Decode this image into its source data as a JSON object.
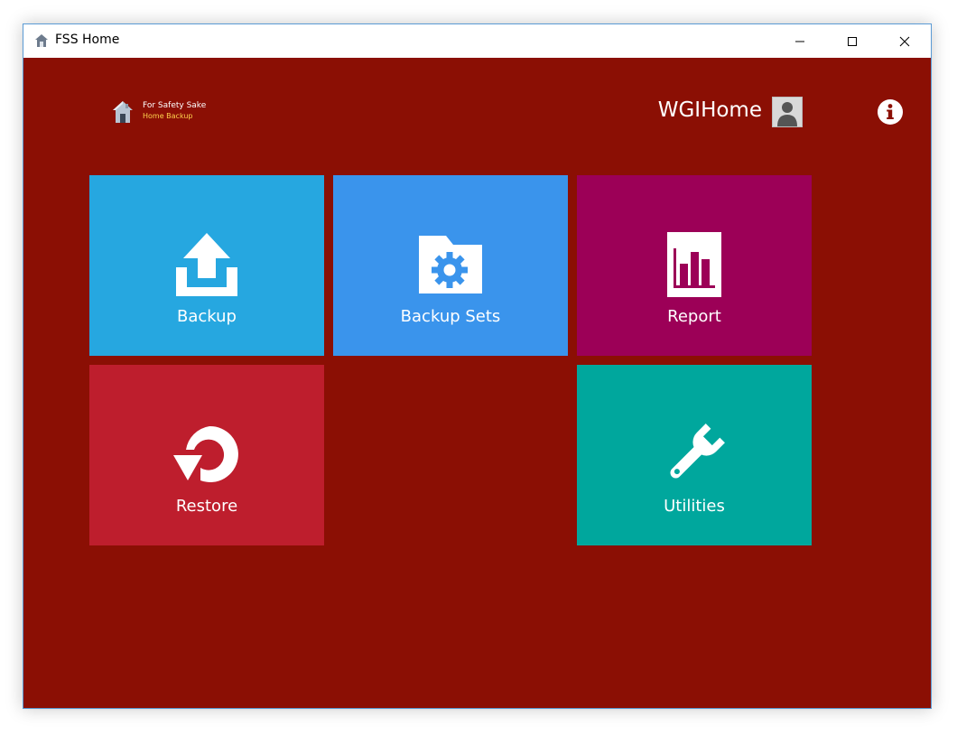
{
  "window": {
    "title": "FSS Home"
  },
  "brand": {
    "line1": "For Safety Sake",
    "line2": "Home Backup"
  },
  "user": {
    "name": "WGIHome"
  },
  "tiles": [
    {
      "label": "Backup",
      "icon": "upload-icon",
      "color": "#26a7e0"
    },
    {
      "label": "Backup Sets",
      "icon": "folder-gear-icon",
      "color": "#3a94ec"
    },
    {
      "label": "Report",
      "icon": "bar-chart-icon",
      "color": "#9c0057"
    },
    {
      "label": "Restore",
      "icon": "restore-icon",
      "color": "#be1e2d"
    },
    {
      "label": "Utilities",
      "icon": "wrench-icon",
      "color": "#00a79d"
    }
  ],
  "colors": {
    "background": "#8b0f04",
    "brand_accent": "#ffd34d"
  }
}
